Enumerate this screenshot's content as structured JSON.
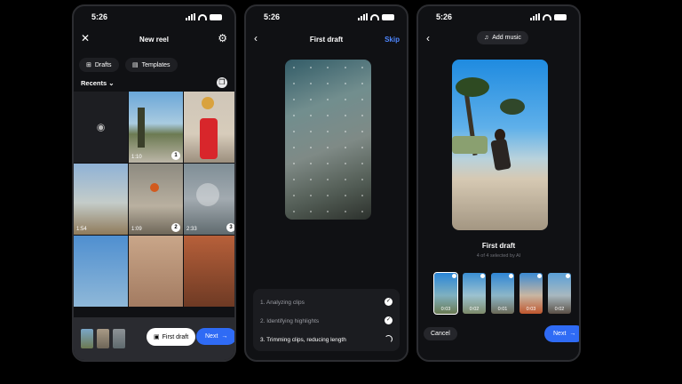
{
  "status": {
    "time": "5:26"
  },
  "screen1": {
    "title": "New reel",
    "tab_drafts": "Drafts",
    "tab_templates": "Templates",
    "recents_label": "Recents",
    "durations": [
      "1:10",
      "1:54",
      "1:09",
      "2:33"
    ],
    "selection_numbers": [
      "1",
      "2",
      "3"
    ],
    "first_draft_label": "First draft",
    "next_label": "Next"
  },
  "screen2": {
    "title": "First draft",
    "skip_label": "Skip",
    "steps": [
      "1. Analyzing clips",
      "2. Identifying highlights",
      "3. Trimming clips, reducing length"
    ]
  },
  "screen3": {
    "add_music_label": "Add music",
    "title": "First draft",
    "subtitle": "4 of 4 selected by AI",
    "clip_durations": [
      "0:03",
      "0:02",
      "0:01",
      "0:03",
      "0:02"
    ],
    "cancel_label": "Cancel",
    "next_label": "Next"
  },
  "colors": {
    "accent": "#2f6bf5",
    "background": "#000000",
    "phone": "#101114"
  },
  "icons": {
    "close": "close-icon",
    "settings": "gear-icon",
    "back": "chevron-left-icon",
    "camera": "camera-icon",
    "music": "music-note-icon",
    "arrow": "arrow-right-icon",
    "check": "check-icon"
  }
}
